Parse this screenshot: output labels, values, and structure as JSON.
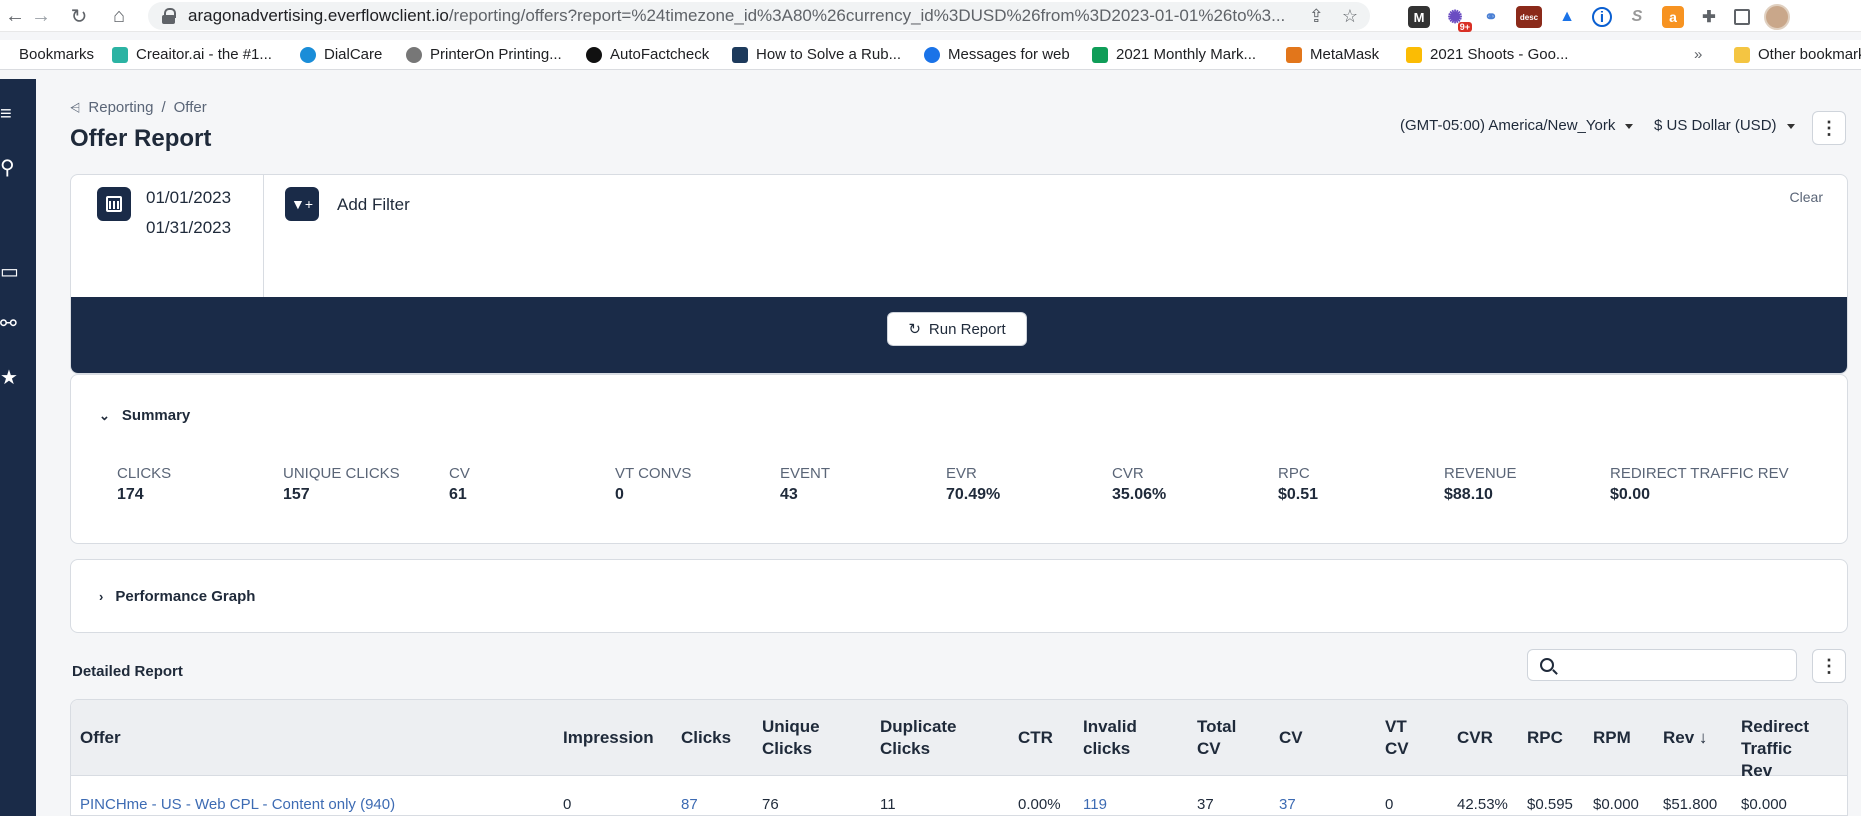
{
  "browser": {
    "url_host": "aragonadvertising.everflowclient.io",
    "url_path": "/reporting/offers?report=%24timezone_id%3A80%26currency_id%3DUSD%26from%3D2023-01-01%26to%3...",
    "badge_count": "9+",
    "ext_desc_label": "desc"
  },
  "bookmarks": [
    {
      "label": "Bookmarks",
      "color": "#5f6368"
    },
    {
      "label": "Creaitor.ai - the #1...",
      "color": "#2bb3a3"
    },
    {
      "label": "DialCare",
      "color": "#1a8dd8"
    },
    {
      "label": "PrinterOn Printing...",
      "color": "#777777"
    },
    {
      "label": "AutoFactcheck",
      "color": "#111111"
    },
    {
      "label": "How to Solve a Rub...",
      "color": "#1d3a5c"
    },
    {
      "label": "Messages for web",
      "color": "#1a73e8"
    },
    {
      "label": "2021 Monthly Mark...",
      "color": "#0f9d58"
    },
    {
      "label": "MetaMask",
      "color": "#e2761b"
    },
    {
      "label": "2021 Shoots - Goo...",
      "color": "#fbbc04"
    },
    {
      "label": "Other bookmarks",
      "color": "#f4c542"
    }
  ],
  "breadcrumb": {
    "root": "Reporting",
    "sep": "/",
    "current": "Offer"
  },
  "page_title": "Offer Report",
  "timezone": "(GMT-05:00) America/New_York",
  "currency": "$ US Dollar (USD)",
  "filter": {
    "date_from": "01/01/2023",
    "date_to": "01/31/2023",
    "add_filter_label": "Add Filter",
    "clear_label": "Clear",
    "run_label": "Run Report"
  },
  "summary": {
    "title": "Summary",
    "metrics": [
      {
        "label": "CLICKS",
        "value": "174"
      },
      {
        "label": "UNIQUE CLICKS",
        "value": "157"
      },
      {
        "label": "CV",
        "value": "61"
      },
      {
        "label": "VT CONVS",
        "value": "0"
      },
      {
        "label": "EVENT",
        "value": "43"
      },
      {
        "label": "EVR",
        "value": "70.49%"
      },
      {
        "label": "CVR",
        "value": "35.06%"
      },
      {
        "label": "RPC",
        "value": "$0.51"
      },
      {
        "label": "REVENUE",
        "value": "$88.10"
      },
      {
        "label": "REDIRECT TRAFFIC REV",
        "value": "$0.00"
      }
    ]
  },
  "performance_graph": {
    "title": "Performance Graph"
  },
  "detailed_report": {
    "title": "Detailed Report",
    "search_placeholder": "",
    "columns": [
      {
        "line1": "Offer",
        "line2": ""
      },
      {
        "line1": "Impression",
        "line2": ""
      },
      {
        "line1": "Clicks",
        "line2": ""
      },
      {
        "line1": "Unique",
        "line2": "Clicks"
      },
      {
        "line1": "Duplicate",
        "line2": "Clicks"
      },
      {
        "line1": "CTR",
        "line2": ""
      },
      {
        "line1": "Invalid",
        "line2": "clicks"
      },
      {
        "line1": "Total",
        "line2": "CV"
      },
      {
        "line1": "CV",
        "line2": ""
      },
      {
        "line1": "VT",
        "line2": "CV"
      },
      {
        "line1": "CVR",
        "line2": ""
      },
      {
        "line1": "RPC",
        "line2": ""
      },
      {
        "line1": "RPM",
        "line2": ""
      },
      {
        "line1": "Rev ↓",
        "line2": ""
      },
      {
        "line1": "Redirect Traffic",
        "line2": "Rev"
      }
    ],
    "rows": [
      [
        "PINCHme - US - Web CPL - Content only (940)",
        "0",
        "87",
        "76",
        "11",
        "0.00%",
        "119",
        "37",
        "37",
        "0",
        "42.53%",
        "$0.595",
        "$0.000",
        "$51.800",
        "$0.000"
      ]
    ]
  }
}
